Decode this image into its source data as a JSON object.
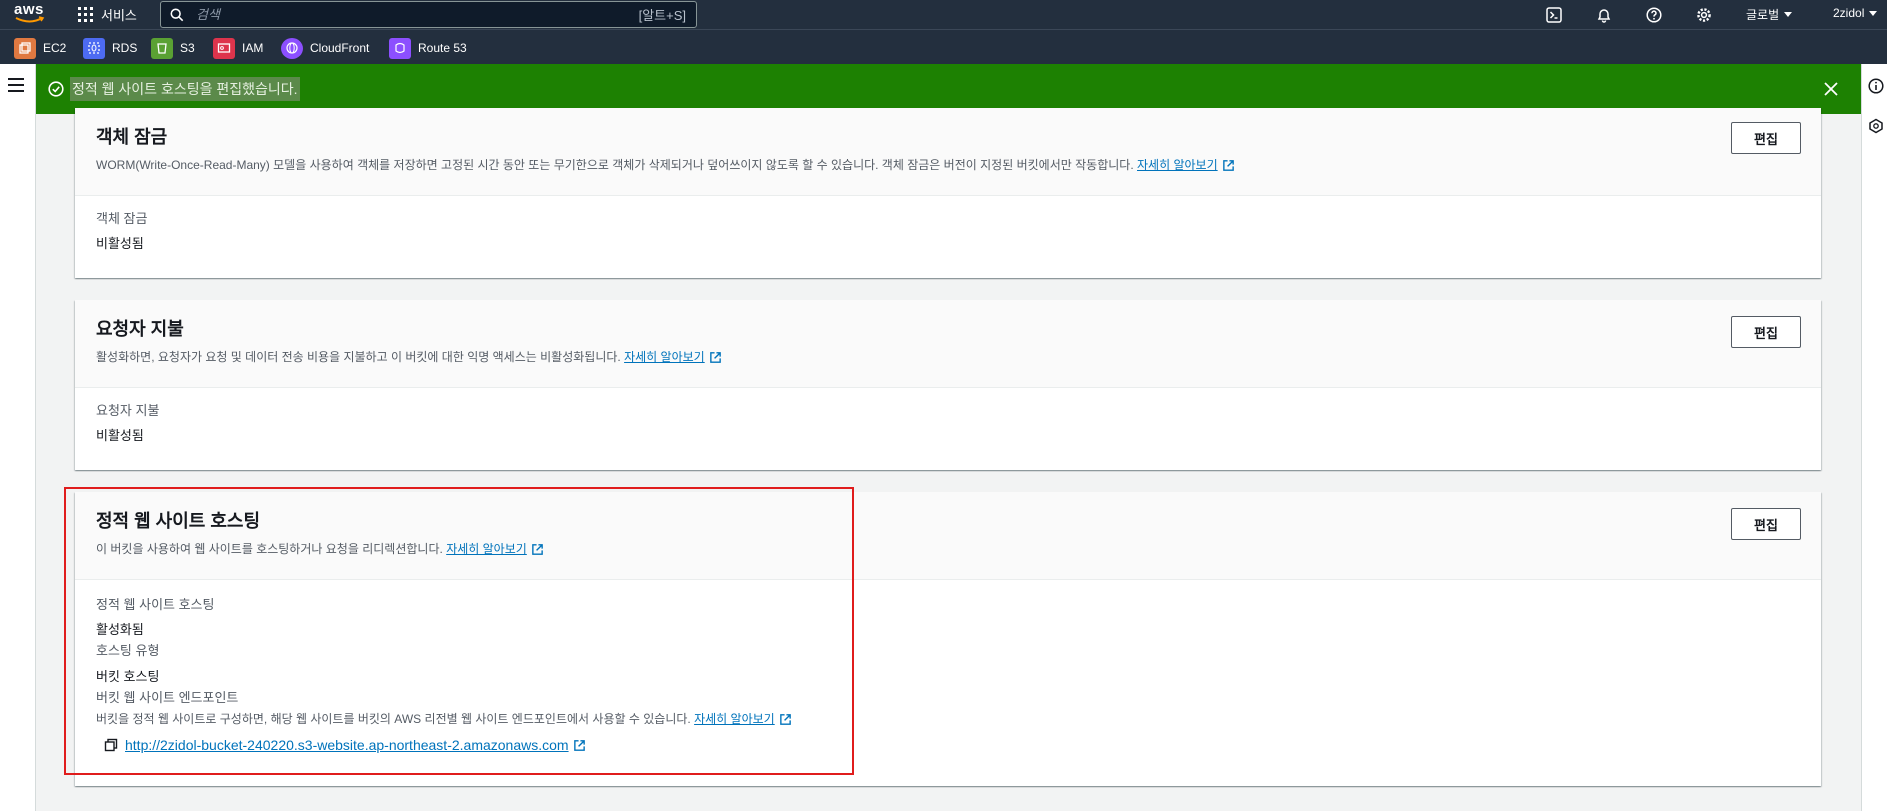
{
  "topnav": {
    "logo_text": "aws",
    "services_label": "서비스",
    "search_placeholder": "검색",
    "search_shortcut": "[알트+S]",
    "region_label": "글로벌",
    "account_label": "2zidol"
  },
  "favorites": [
    {
      "label": "EC2",
      "color": "#e07941",
      "icon": "ec2-icon"
    },
    {
      "label": "RDS",
      "color": "#4d6bf2",
      "icon": "rds-icon"
    },
    {
      "label": "S3",
      "color": "#5aa133",
      "icon": "s3-icon"
    },
    {
      "label": "IAM",
      "color": "#dd344c",
      "icon": "iam-icon"
    },
    {
      "label": "CloudFront",
      "color": "#8c4fff",
      "icon": "cloudfront-icon"
    },
    {
      "label": "Route 53",
      "color": "#8c4fff",
      "icon": "route53-icon"
    }
  ],
  "flash": {
    "message": "정적 웹 사이트 호스팅을 편집했습니다.",
    "color": "#1d8102"
  },
  "object_lock": {
    "title": "객체 잠금",
    "description": "WORM(Write-Once-Read-Many) 모델을 사용하여 객체를 저장하면 고정된 시간 동안 또는 무기한으로 객체가 삭제되거나 덮어쓰이지 않도록 할 수 있습니다. 객체 잠금은 버전이 지정된 버킷에서만 작동합니다.",
    "learn_more": "자세히 알아보기",
    "edit_label": "편집",
    "field_label": "객체 잠금",
    "field_value": "비활성됨"
  },
  "requester_pays": {
    "title": "요청자 지불",
    "description": "활성화하면, 요청자가 요청 및 데이터 전송 비용을 지불하고 이 버킷에 대한 익명 액세스는 비활성화됩니다.",
    "learn_more": "자세히 알아보기",
    "edit_label": "편집",
    "field_label": "요청자 지불",
    "field_value": "비활성됨"
  },
  "static_hosting": {
    "title": "정적 웹 사이트 호스팅",
    "description": "이 버킷을 사용하여 웹 사이트를 호스팅하거나 요청을 리디렉션합니다.",
    "learn_more": "자세히 알아보기",
    "edit_label": "편집",
    "status_label": "정적 웹 사이트 호스팅",
    "status_value": "활성화됨",
    "type_label": "호스팅 유형",
    "type_value": "버킷 호스팅",
    "endpoint_label": "버킷 웹 사이트 엔드포인트",
    "endpoint_desc": "버킷을 정적 웹 사이트로 구성하면, 해당 웹 사이트를 버킷의 AWS 리전별 웹 사이트 엔드포인트에서 사용할 수 있습니다.",
    "endpoint_learn_more": "자세히 알아보기",
    "endpoint_url": "http://2zidol-bucket-240220.s3-website.ap-northeast-2.amazonaws.com"
  },
  "colors": {
    "nav_bg": "#232f3e",
    "link": "#0073bb",
    "highlight_box": "#e01c1c"
  }
}
